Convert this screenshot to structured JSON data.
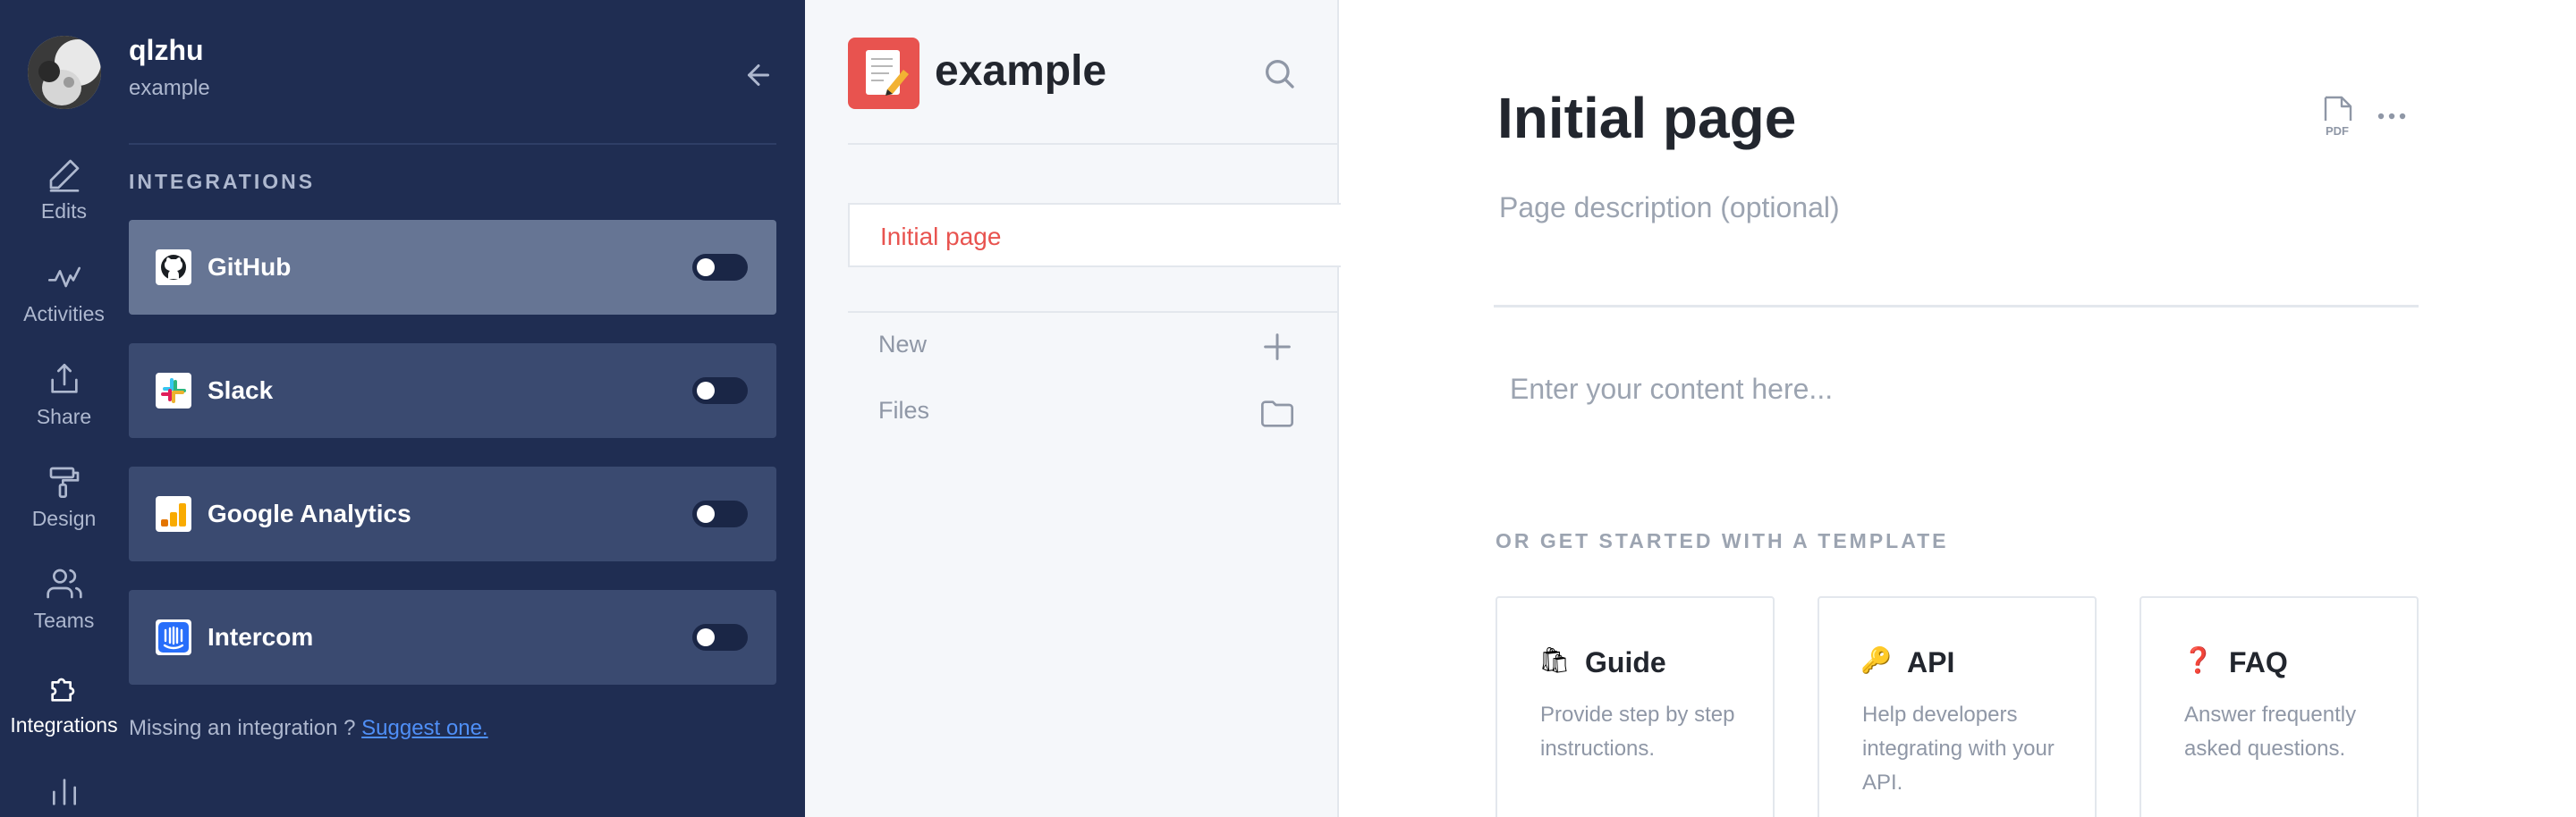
{
  "user": {
    "name": "qlzhu",
    "space": "example"
  },
  "rail": [
    {
      "label": "Edits",
      "icon": "pencil-icon"
    },
    {
      "label": "Activities",
      "icon": "activity-icon"
    },
    {
      "label": "Share",
      "icon": "share-icon"
    },
    {
      "label": "Design",
      "icon": "paint-roller-icon"
    },
    {
      "label": "Teams",
      "icon": "users-icon"
    },
    {
      "label": "Integrations",
      "icon": "puzzle-icon",
      "active": true
    },
    {
      "label": "",
      "icon": "bar-chart-icon"
    }
  ],
  "integrations": {
    "title": "INTEGRATIONS",
    "items": [
      {
        "name": "GitHub",
        "icon": "github-icon",
        "enabled": false,
        "active": true
      },
      {
        "name": "Slack",
        "icon": "slack-icon",
        "enabled": false
      },
      {
        "name": "Google Analytics",
        "icon": "google-analytics-icon",
        "enabled": false
      },
      {
        "name": "Intercom",
        "icon": "intercom-icon",
        "enabled": false
      }
    ],
    "missing_text": "Missing an integration ?",
    "suggest_link": "Suggest one."
  },
  "nav": {
    "space_title": "example",
    "current_page": "Initial page",
    "new_label": "New",
    "files_label": "Files"
  },
  "editor": {
    "title": "Initial page",
    "description_placeholder": "Page description (optional)",
    "content_placeholder": "Enter your content here...",
    "pdf_label": "PDF",
    "templates_title": "OR GET STARTED WITH A TEMPLATE",
    "templates": [
      {
        "emoji": "🛍",
        "name": "Guide",
        "desc": "Provide step by step instructions."
      },
      {
        "emoji": "🔑",
        "name": "API",
        "desc": "Help developers integrating with your API."
      },
      {
        "emoji": "❓",
        "name": "FAQ",
        "desc": "Answer frequently asked questions."
      }
    ]
  },
  "colors": {
    "sidebar_bg": "#1f2d52",
    "card_bg": "#3a4a70",
    "card_active_bg": "#667594",
    "accent": "#e8534f",
    "link": "#4f8ff7"
  }
}
